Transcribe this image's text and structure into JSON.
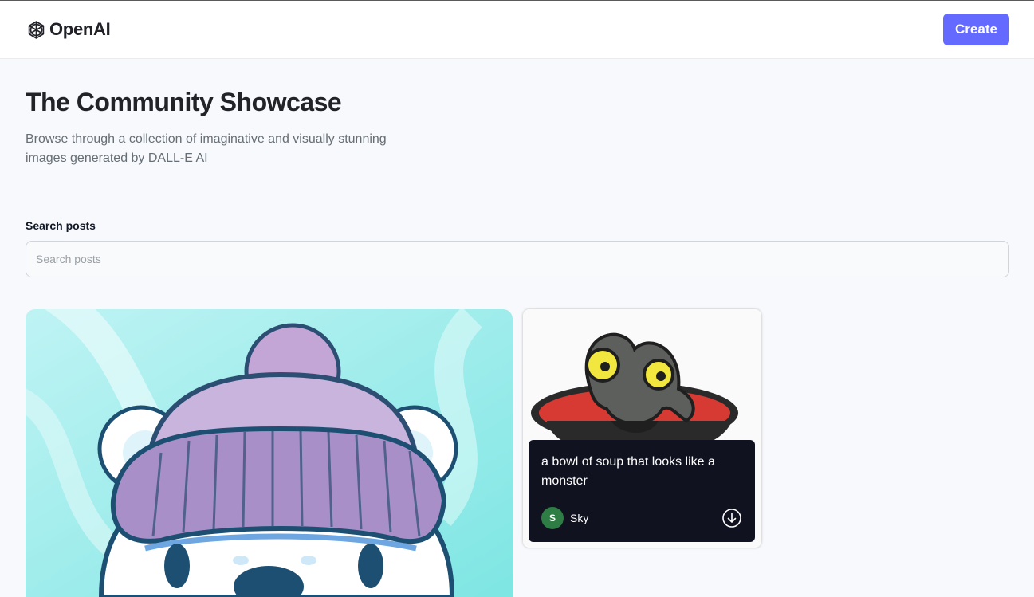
{
  "header": {
    "logo_text": "OpenAI",
    "create_label": "Create"
  },
  "hero": {
    "title": "The Community Showcase",
    "subtitle": "Browse through a collection of imaginative and visually stunning images generated by DALL-E AI"
  },
  "search": {
    "label": "Search posts",
    "placeholder": "Search posts",
    "value": ""
  },
  "posts": [
    {
      "image": "bear-in-purple-beanie"
    },
    {
      "image": "monster-soup-bowl",
      "prompt": "a bowl of soup that looks like a monster",
      "author": "Sky",
      "author_initial": "S",
      "action_icon": "download-icon"
    }
  ],
  "colors": {
    "accent": "#6469ff",
    "overlay": "#10131f",
    "avatar": "#2e7d44",
    "page_bg": "#f8f9fc"
  }
}
